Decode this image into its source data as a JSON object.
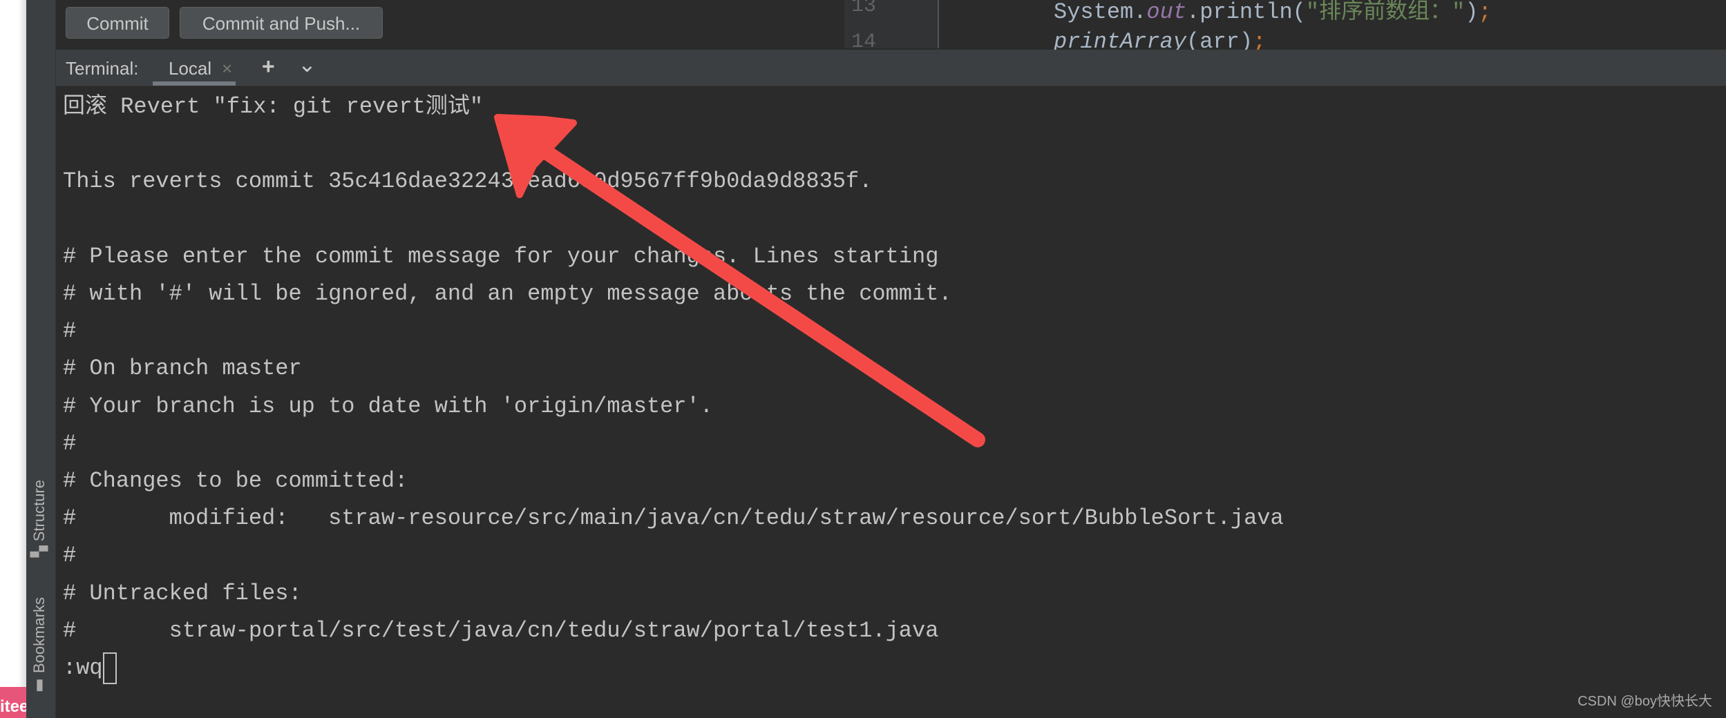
{
  "toolbar": {
    "commit_label": "Commit",
    "commit_push_label": "Commit and Push..."
  },
  "editor": {
    "line_numbers": [
      "13",
      "14"
    ],
    "code": [
      {
        "a": "System.",
        "b": "out",
        "c": ".println(",
        "d": "\"排序前数组：\"",
        "e": ")",
        ";": ";"
      },
      {
        "a": "printArray",
        "b": "(arr)",
        "semi": ";"
      }
    ]
  },
  "terminal": {
    "label": "Terminal:",
    "tab": "Local",
    "close": "×",
    "add": "+",
    "more": "⌄",
    "lines": [
      "回滚 Revert \"fix: git revert测试\"",
      "",
      "This reverts commit 35c416dae322435ead630d9567ff9b0da9d8835f.",
      "",
      "# Please enter the commit message for your changes. Lines starting",
      "# with '#' will be ignored, and an empty message aborts the commit.",
      "#",
      "# On branch master",
      "# Your branch is up to date with 'origin/master'.",
      "#",
      "# Changes to be committed:",
      "#       modified:   straw-resource/src/main/java/cn/tedu/straw/resource/sort/BubbleSort.java",
      "#",
      "# Untracked files:",
      "#       straw-portal/src/test/java/cn/tedu/straw/portal/test1.java",
      ":wq"
    ]
  },
  "side_tools": {
    "structure": "Structure",
    "bookmarks": "Bookmarks"
  },
  "badge": "itee",
  "watermark": "CSDN @boy快快长大",
  "colors": {
    "arrow": "#f44a47",
    "bg": "#2b2b2b",
    "panel": "#3c3f41"
  }
}
